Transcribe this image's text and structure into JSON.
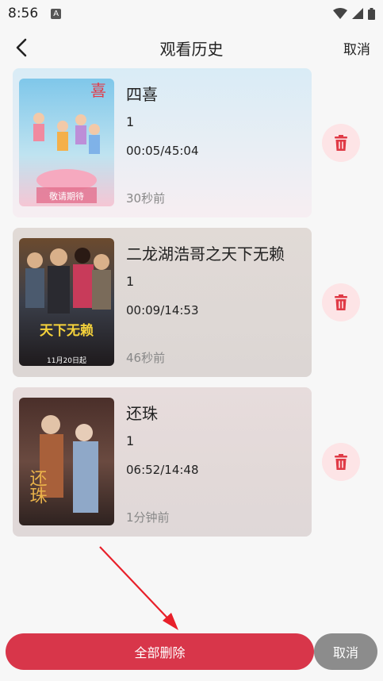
{
  "status_bar": {
    "time": "8:56",
    "notification_letter": "A"
  },
  "header": {
    "title": "观看历史",
    "cancel_label": "取消"
  },
  "history": [
    {
      "title": "四喜",
      "episode": "1",
      "progress": "00:05/45:04",
      "watched_ago": "30秒前"
    },
    {
      "title": "二龙湖浩哥之天下无赖",
      "episode": "1",
      "progress": "00:09/14:53",
      "watched_ago": "46秒前"
    },
    {
      "title": "还珠",
      "episode": "1",
      "progress": "06:52/14:48",
      "watched_ago": "1分钟前"
    }
  ],
  "posters": {
    "p1_top_text": "喜",
    "p1_bottom_text": "敬请期待",
    "p2_big_text": "天下无赖",
    "p2_date": "11月20日起",
    "p3_text": "还珠"
  },
  "bottom": {
    "delete_all_label": "全部删除",
    "cancel_label": "取消"
  },
  "colors": {
    "accent_red": "#d8364a",
    "delete_bg": "#fde4e6",
    "cancel_gray": "#8c8c8c"
  }
}
